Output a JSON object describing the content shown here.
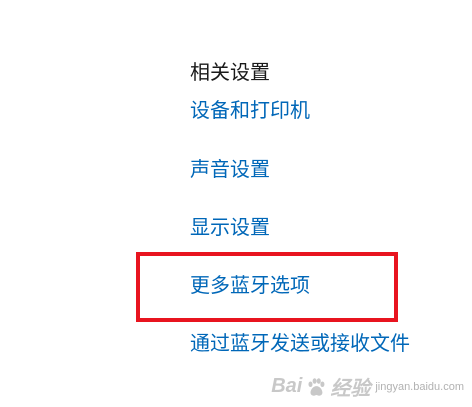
{
  "related_settings": {
    "title": "相关设置",
    "links": [
      {
        "label": "设备和打印机"
      },
      {
        "label": "声音设置"
      },
      {
        "label": "显示设置"
      },
      {
        "label": "更多蓝牙选项"
      },
      {
        "label": "通过蓝牙发送或接收文件"
      }
    ]
  },
  "highlight": {
    "color": "#e8141f",
    "target": "更多蓝牙选项"
  },
  "colors": {
    "link": "#0067b8",
    "title": "#1a1a1a",
    "background": "#ffffff"
  },
  "watermark": {
    "brand": "Bai",
    "brand_tail": "经验",
    "icon": "paw-icon",
    "domain": "jingyan.baidu.com"
  }
}
